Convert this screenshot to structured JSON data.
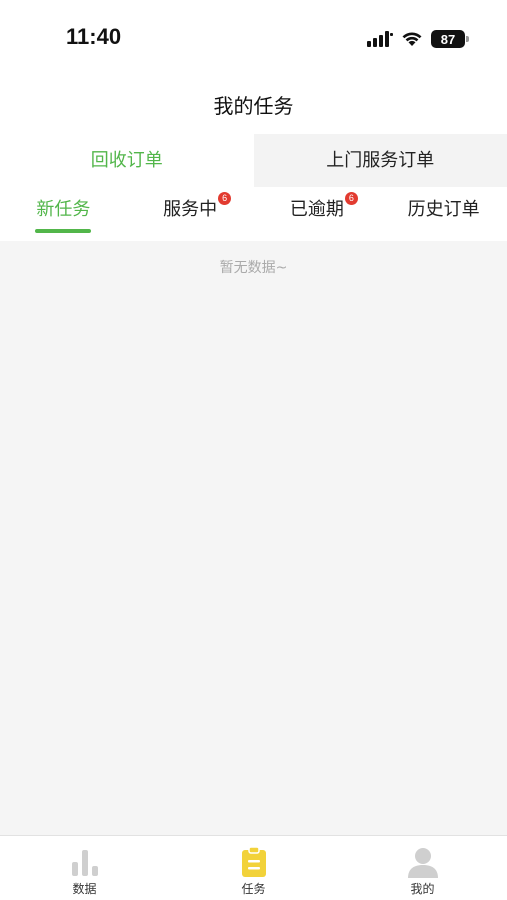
{
  "status_bar": {
    "time": "11:40",
    "battery": "87"
  },
  "nav": {
    "title": "我的任务"
  },
  "order_tabs": [
    {
      "label": "回收订单",
      "active": true
    },
    {
      "label": "上门服务订单",
      "active": false
    }
  ],
  "status_tabs": [
    {
      "label": "新任务",
      "active": true,
      "badge": ""
    },
    {
      "label": "服务中",
      "active": false,
      "badge": "6"
    },
    {
      "label": "已逾期",
      "active": false,
      "badge": "6"
    },
    {
      "label": "历史订单",
      "active": false,
      "badge": ""
    }
  ],
  "content": {
    "empty_text": "暂无数据~"
  },
  "tab_bar": [
    {
      "label": "数据",
      "icon": "bar-chart-icon",
      "active": false
    },
    {
      "label": "任务",
      "icon": "clipboard-icon",
      "active": true
    },
    {
      "label": "我的",
      "icon": "person-icon",
      "active": false
    }
  ],
  "colors": {
    "accent": "#52b64a",
    "badge": "#e23b30",
    "active_tab_icon": "#f2d23a",
    "inactive_tab_icon": "#cfcfcf"
  }
}
